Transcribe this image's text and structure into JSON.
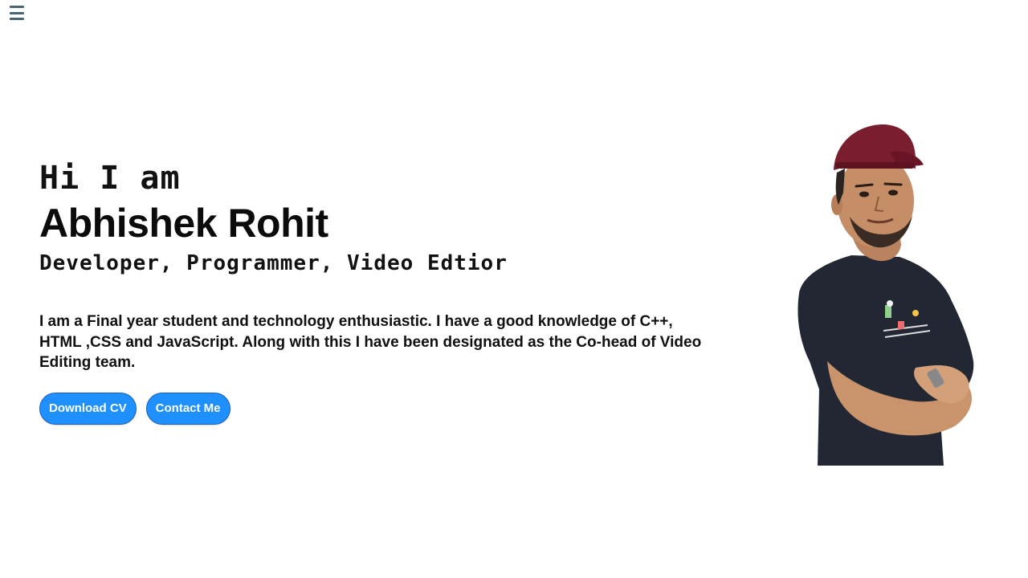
{
  "nav": {
    "menu_icon": "hamburger-menu-icon"
  },
  "hero": {
    "greeting": "Hi I am",
    "name": "Abhishek Rohit",
    "roles": "Developer, Programmer, Video Edtior",
    "bio": "I am a Final year student and technology enthusiastic. I have a good knowledge of C++, HTML ,CSS and JavaScript. Along with this I have been designated as the Co-head of Video Editing team.",
    "buttons": {
      "download_cv": "Download CV",
      "contact_me": "Contact Me"
    }
  },
  "colors": {
    "accent": "#1e90ff",
    "menu_icon": "#4a6478",
    "text": "#111111",
    "background": "#ffffff"
  },
  "image": {
    "subject": "portrait-photo"
  }
}
